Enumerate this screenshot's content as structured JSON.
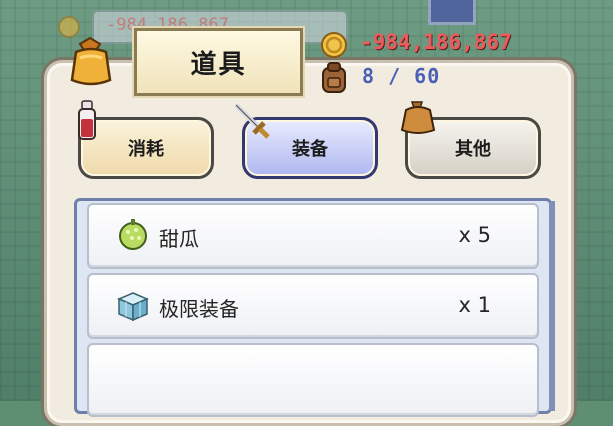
{
  "header": {
    "title": "道具",
    "gold": "-984,186,867",
    "capacity": "8 / 60"
  },
  "background": {
    "gold": "-984,186,867"
  },
  "tabs": [
    {
      "label": "消耗",
      "selected": false
    },
    {
      "label": "装备",
      "selected": true
    },
    {
      "label": "其他",
      "selected": false
    }
  ],
  "items": [
    {
      "name": "甜瓜",
      "qty": "x 5",
      "icon": "melon-icon"
    },
    {
      "name": "极限装备",
      "qty": "x 1",
      "icon": "ice-cube-icon"
    }
  ],
  "colors": {
    "gold_text": "#ea5b5b",
    "capacity_text": "#4c5fb6",
    "selected_tab": "#aeb6ef"
  }
}
